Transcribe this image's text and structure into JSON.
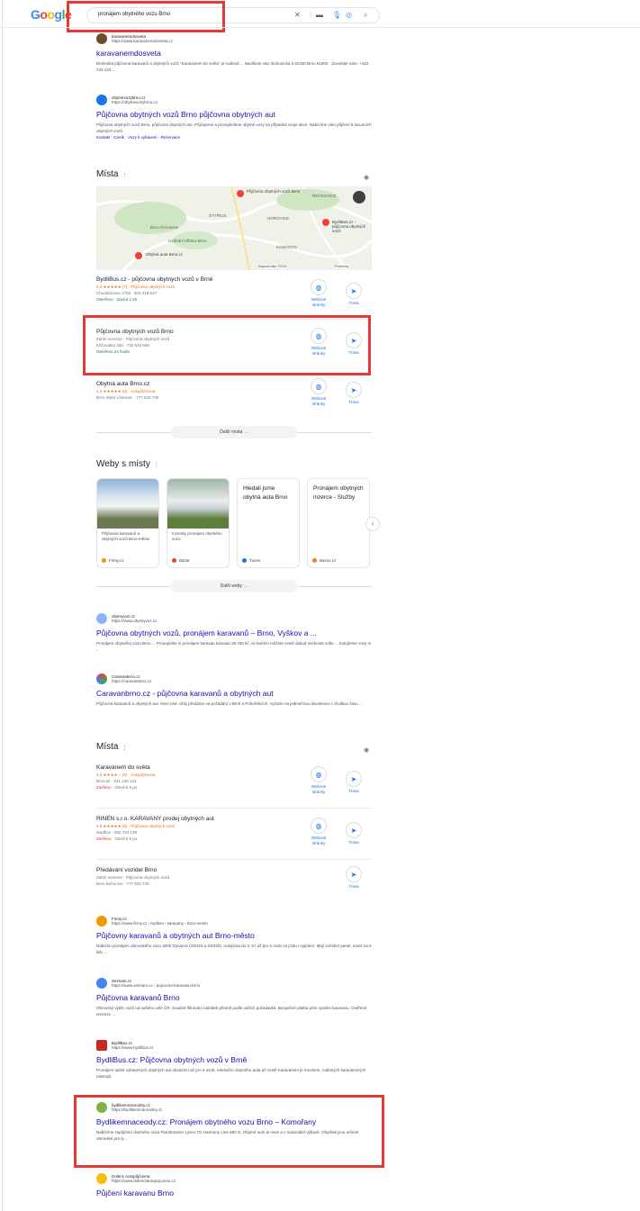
{
  "header": {
    "logo": "Google",
    "query": "pronájem obytného vozu Brno"
  },
  "results_top": [
    {
      "site": "karavanemdosveta",
      "url": "https://www.karavanemdosveta.cz",
      "title": "karavanemdosveta",
      "snippet": "Brněnská půjčovna karavanů a obytných vozů \"Karavanem do světa\" je rodinná ... Navštivte nás: Bohunická 5 62400 Brno 61900 · Zavolejte nám: +420 733 133 ..."
    },
    {
      "site": "obytnevozybrno.cz",
      "url": "https://obytnevozybrno.cz",
      "title": "Půjčovna obytných vozů Brno půjčovna obytných aut",
      "snippet": "Půjčovna obytných vozů Brno, půjčovna obytných aut. Půjčujeme a pronajímáme obytné vozy na případné svoje akce. Nabízíme vám půjčení 5 luxusních obytných vozů.",
      "links": "Kontakt · Ceník · Vozy k vybavení · Rezervace"
    }
  ],
  "places1": {
    "title": "Místa",
    "map_labels": [
      "Půjčovna obytných vozů Brno",
      "Obytná auta Brno.cz",
      "BydliBus.cz - půjčovna obytných vozů",
      "Ústřední hřbitov Brno",
      "ŠTÝŘICE",
      "HOROVICE",
      "KOMÁROV",
      "ŘEČKOVICE",
      "Brno-Černovice",
      "Mapová data ©2024",
      "Podmínky"
    ],
    "items": [
      {
        "name": "BydliBus.cz - půjčovna obytných vozů v Brně",
        "rating": "5,0 ★★★★★ (7) · Půjčovna obytných vozů",
        "address": "Chudobínova 170a · 603 419 537",
        "status": "Otevřeno · Zavírá v 18",
        "web": "Webové stránky",
        "route": "Trasa"
      },
      {
        "name": "Půjčovna obytných vozů Brno",
        "rating": "Zatím recenze · Půjčovna obytných vozů",
        "address": "Křižovatka 33a · 732 625 659",
        "status": "Otevřeno 24 hodin",
        "web": "Webové stránky",
        "route": "Trasa"
      },
      {
        "name": "Obytná auta Brno.cz",
        "rating": "4,3 ★★★★★ (6) · Autopůjčovna",
        "address": "Brno Starý Lískovec · 777 620 730",
        "status": "",
        "web": "Webové stránky",
        "route": "Trasa"
      }
    ],
    "more": "Další místa →"
  },
  "webs": {
    "title": "Weby s místy",
    "cards": [
      {
        "text": "Půjčovna karavanů a obytných vozů Brno-město",
        "source": "Firmy.cz"
      },
      {
        "text": "Inzeráty pronájem obytného vozu",
        "source": "Bazar"
      },
      {
        "text": "Hledali jsme obytná auta Brno",
        "source": "Tuzex"
      },
      {
        "text": "Pronájem obytných inzerce - Služby",
        "source": "Bazos.cz"
      }
    ],
    "more": "Další weby →"
  },
  "results_mid": [
    {
      "site": "obytnyvuz.cz",
      "url": "https://www.obytnyvuz.cz",
      "title": "Půjčovna obytných vozů, pronájem karavanů – Brno, Vyškov a ...",
      "snippet": "Pronájem obytného vozu Brno ... Pronajměte si pronájem karavan karavan 28.750 kč, ve kterém můžete cestě dokud nechcete sofie ... Kolujíeme vozy si ..."
    },
    {
      "site": "Caravanbrno.cz",
      "url": "https://caravanbrno.cz",
      "title": "Caravanbrno.cz - půjčovna karavanů a obytných aut",
      "snippet": "Půjčovna karavanů a obytných aut. Kterí vám vždy předáme na požádání v Brně a Pohořelicích. Vyrazte na jedinečnou dovolenou s chvilkou času ..."
    }
  ],
  "places2": {
    "title": "Místa",
    "items": [
      {
        "name": "Karavanem do světa",
        "rating": "4,3 ★★★★☆ (6) · Autopůjčovna",
        "address": "Brno-jih · 541 240 124",
        "status_closed": "Zavřeno",
        "status_rest": " · Otevírá 8 po",
        "web": "Webové stránky",
        "route": "Trasa"
      },
      {
        "name": "RINEN s.r.o. KARAVANY prodej obytných aut",
        "rating": "4,8 ★★★★★ (8) · Půjčovna obytných vozů",
        "address": "Modřice · 602 724 139",
        "status_closed": "Zavřeno",
        "status_rest": " · Otevírá 9 po",
        "web": "Webové stránky",
        "route": "Trasa"
      },
      {
        "name": "Předávání vozidel Brno",
        "rating": "Zatím recenze · Půjčovna obytných vozů",
        "address": "Brno Bohunice · 777 620 730",
        "route": "Trasa"
      }
    ]
  },
  "results_bottom": [
    {
      "site": "Firmy.cz",
      "url": "https://www.firmy.cz › bydleni › karavany › brno-mesto",
      "title": "Půjčovny karavanů a obytných aut Brno-město",
      "snippet": "Nabízím pronájem obrovského vozu 3000 Dynamic (SD319 a SD320). Autojízna do 3, 8 t až pro 6 osob na jízdu i nyjídení. Mají vučební panel, mozit na 6 lidu ..."
    },
    {
      "site": "Seznam.cz",
      "url": "https://www.seznam.cz › pujcovna-karavanu-brno",
      "title": "Půjčovna karavanů Brno",
      "snippet": "Obrovský výběr vozů od našeho celé ČR. Snadné filtrování nabídek přesně podle vašich požadavků. Bezpečné platba přes systém karavanu. Ověřené recenze ..."
    },
    {
      "site": "BydliBus.cz",
      "url": "https://www.bydlibus.cz",
      "title": "BydliBus.cz: Půjčovna obytných vozů v Brně",
      "snippet": "Pronájem úplně vybavených obytných aut obsazení až pro 6 osob. rekreační obytného auta při cestě Karavanem je mnohem, rodinných karavanových nástrojů."
    },
    {
      "site": "bydlikemnaceodny.cz",
      "url": "https://bydlikemnaceodny.cz",
      "title": "Bydlikemnaceody.cz: Pronájem obytného vozu Brno – Komořany",
      "snippet": "Nabízíme zapůjčení obytného vozu Fiat Bürstner Lyseo TD Harmony Line 690 G. Obytné auto je nové a v maximální výbavě. Obytňák jsou určené obrovské pro ty ..."
    },
    {
      "site": "Dolenc Autopůjčovna",
      "url": "https://www.dolenctautopujcovna.cz",
      "title": "Půjčení karavanu Brno",
      "snippet": ""
    }
  ]
}
